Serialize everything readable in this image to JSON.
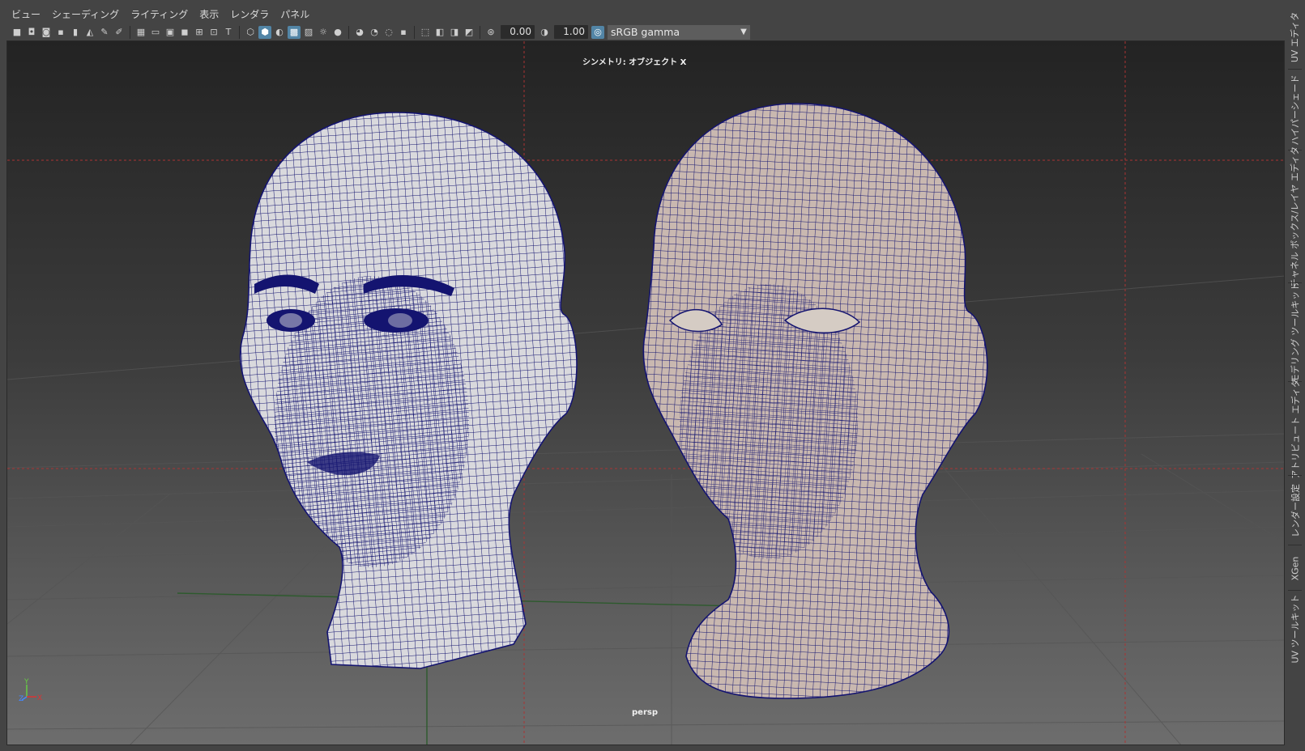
{
  "menu": [
    "ビュー",
    "シェーディング",
    "ライティング",
    "表示",
    "レンダラ",
    "パネル"
  ],
  "toolbar": {
    "field1_value": "0.00",
    "field2_value": "1.00",
    "colorspace": "sRGB gamma"
  },
  "viewport": {
    "symmetry_label": "シンメトリ: オブジェクト X",
    "camera_label": "persp",
    "axis_labels": {
      "y": "Y",
      "z": "Z",
      "x": "X"
    }
  },
  "right_tabs": [
    "UV エディタ",
    "ハイパーシェード",
    "チャネル ボックス/レイヤ エディタ",
    "モデリング ツールキット",
    "アトリビュート エディタ",
    "レンダー設定",
    "XGen",
    "UV ツールキット"
  ],
  "colors": {
    "ui_bg": "#444444",
    "wireframe": "#101070",
    "head_left_fill": "#d9d9dd",
    "head_right_fill": "#c9b8b0",
    "accent": "#5285a6"
  }
}
